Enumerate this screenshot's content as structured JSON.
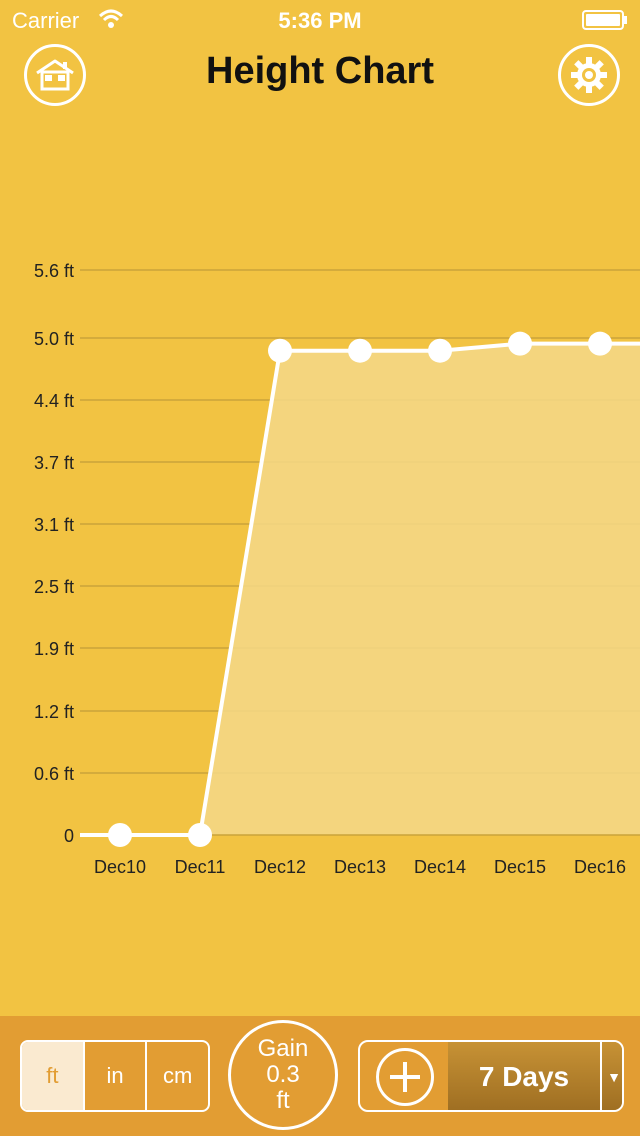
{
  "status_bar": {
    "carrier": "Carrier",
    "time": "5:36 PM"
  },
  "nav": {
    "title": "Height Chart",
    "home_icon": "house-icon",
    "settings_icon": "gear-icon"
  },
  "chart_data": {
    "type": "area",
    "title": "",
    "x": [
      "Dec10",
      "Dec11",
      "Dec12",
      "Dec13",
      "Dec14",
      "Dec15",
      "Dec16"
    ],
    "values": [
      0,
      0,
      4.8,
      4.8,
      4.8,
      4.87,
      4.87
    ],
    "y_ticks": [
      "0",
      "0.6 ft",
      "1.2 ft",
      "1.9 ft",
      "2.5 ft",
      "3.1 ft",
      "3.7 ft",
      "4.4 ft",
      "5.0 ft",
      "5.6 ft"
    ],
    "ylim": [
      0,
      5.6
    ],
    "grid": true,
    "colors": {
      "line": "#FFFFFF",
      "fill": "#F5D888",
      "grid": "#C9A33A",
      "background": "#F2C342"
    }
  },
  "footer": {
    "units": [
      {
        "label": "ft",
        "active": true
      },
      {
        "label": "in",
        "active": false
      },
      {
        "label": "cm",
        "active": false
      }
    ],
    "gain_label": "Gain",
    "gain_value": "0.3",
    "gain_unit": "ft",
    "range_label": "7 Days",
    "range_caret": "▼"
  }
}
